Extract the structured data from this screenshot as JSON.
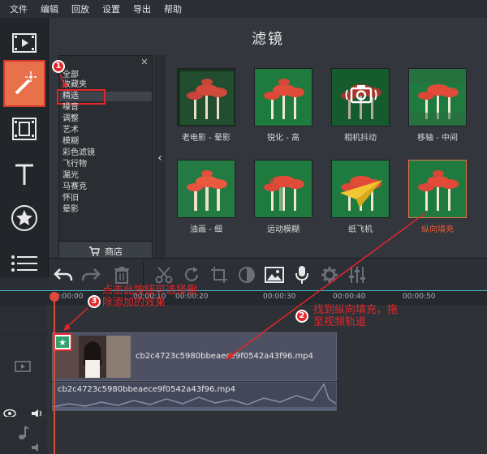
{
  "menubar": {
    "items": [
      "文件",
      "编辑",
      "回放",
      "设置",
      "导出",
      "帮助"
    ]
  },
  "panel": {
    "title": "滤镜",
    "categories": [
      "全部",
      "收藏夹",
      "精选",
      "噪音",
      "调整",
      "艺术",
      "模糊",
      "彩色滤镜",
      "飞行物",
      "漏光",
      "马赛克",
      "怀旧",
      "晕影"
    ],
    "selected_category": "精选",
    "shop_label": "商店",
    "filters": [
      {
        "label": "老电影 - 晕影"
      },
      {
        "label": "锐化 - 高"
      },
      {
        "label": "相机抖动"
      },
      {
        "label": "移轴 - 中间"
      },
      {
        "label": "油画 - 细"
      },
      {
        "label": "运动模糊"
      },
      {
        "label": "纸飞机"
      },
      {
        "label": "纵向填充"
      }
    ],
    "selected_filter": "纵向填充"
  },
  "timeline": {
    "ticks": [
      "00:00:00",
      "00:00:10",
      "00:00:20",
      "00:00:30",
      "00:00:40",
      "00:00:50"
    ],
    "video_clip_name": "cb2c4723c5980bbeaece9f0542a43f96.mp4",
    "audio_clip_name": "cb2c4723c5980bbeaece9f0542a43f96.mp4"
  },
  "annotations": {
    "badge1": "1",
    "badge2": "2",
    "badge3": "3",
    "note2": "找到纵向填充，拖至视频轨道",
    "note3": "点击此按钮可选择删除添加的效果"
  },
  "colors": {
    "accent": "#e8704a",
    "annotation_red": "#e4262a",
    "selected_label": "#e85d3a",
    "ruler_line": "#43b5c7"
  }
}
